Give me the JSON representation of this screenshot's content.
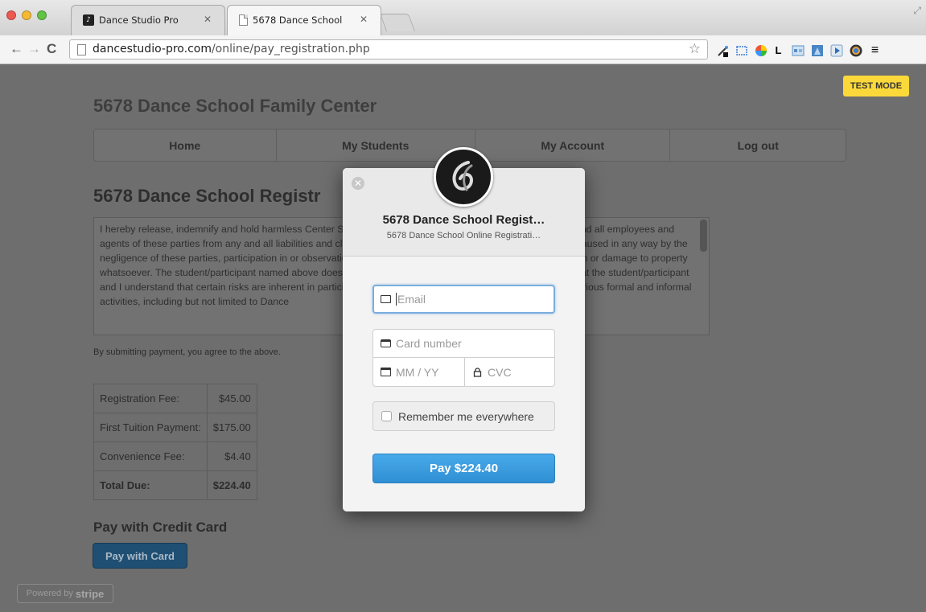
{
  "browser": {
    "tabs": [
      {
        "title": "Dance Studio Pro",
        "active": false
      },
      {
        "title": "5678 Dance School",
        "active": true
      }
    ],
    "url_domain": "dancestudio-pro.com",
    "url_path": "/online/pay_registration.php",
    "extensions": [
      "eyedropper-icon",
      "screenshot-icon",
      "color-wheel-icon",
      "L",
      "window-icon",
      "image-icon",
      "play-icon",
      "chrome-icon",
      "menu-icon"
    ]
  },
  "page": {
    "test_mode": "TEST MODE",
    "site_title": "5678 Dance School Family Center",
    "nav": [
      "Home",
      "My Students",
      "My Account",
      "Log out"
    ],
    "section_heading": "5678 Dance School Registr",
    "waiver_text": "I hereby release, indemnify and hold harmless Center Stage, its officers, members of the Board of Directors, and all employees and agents of these parties from any and all liabilities and claims of any kind or nature, legal or financial, whether caused in any way by the negligence of these parties, participation in or observation of any Center Stage activity for injuries to any person or damage to property whatsoever. The student/participant named above does voluntarily participate in Center Stage activities and that the student/participant and I understand that certain risks are inherent in participation and involvement with Center Stage and in its various formal and informal activities, including but not limited to Dance",
    "agree_text": "By submitting payment, you agree to the above.",
    "fees": [
      {
        "label": "Registration Fee:",
        "amount": "$45.00"
      },
      {
        "label": "First Tuition Payment:",
        "amount": "$175.00"
      },
      {
        "label": "Convenience Fee:",
        "amount": "$4.40"
      },
      {
        "label": "Total Due:",
        "amount": "$224.40"
      }
    ],
    "pay_heading": "Pay with Credit Card",
    "pay_card_button": "Pay with Card",
    "powered_by": "Powered by",
    "powered_brand": "stripe"
  },
  "modal": {
    "title": "5678 Dance School Regist…",
    "subtitle": "5678 Dance School Online Registrati…",
    "email_placeholder": "Email",
    "card_placeholder": "Card number",
    "expiry_placeholder": "MM / YY",
    "cvc_placeholder": "CVC",
    "remember_label": "Remember me everywhere",
    "pay_button": "Pay $224.40"
  },
  "colors": {
    "pay_button": "#3a9be0",
    "test_mode_badge": "#fbd93a",
    "overlay": "#6e6e6e"
  }
}
